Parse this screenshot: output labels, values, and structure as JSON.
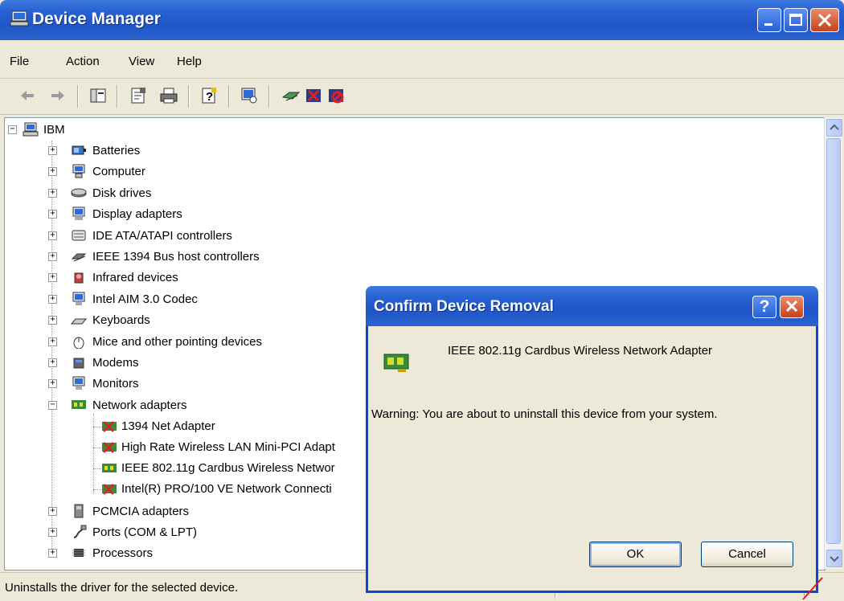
{
  "window": {
    "title": "Device Manager"
  },
  "menubar": {
    "items": [
      "File",
      "Action",
      "View",
      "Help"
    ]
  },
  "toolbar": {
    "tools": [
      "back-arrow-icon",
      "forward-arrow-icon",
      "show-hide-console-tree-icon",
      "properties-icon",
      "print-icon",
      "help-icon",
      "scan-hardware-icon",
      "update-driver-icon",
      "uninstall-icon",
      "disable-icon"
    ]
  },
  "tree": {
    "root": "IBM",
    "categories": [
      "Batteries",
      "Computer",
      "Disk drives",
      "Display adapters",
      "IDE ATA/ATAPI controllers",
      "IEEE 1394 Bus host controllers",
      "Infrared devices",
      "Intel AIM 3.0 Codec",
      "Keyboards",
      "Mice and other pointing devices",
      "Modems",
      "Monitors",
      "Network adapters"
    ],
    "network_adapters": [
      "1394 Net Adapter",
      "High Rate Wireless LAN Mini-PCI Adapt",
      "IEEE 802.11g Cardbus Wireless Networ",
      "Intel(R) PRO/100 VE Network Connecti"
    ],
    "more_categories": [
      "PCMCIA adapters",
      "Ports (COM & LPT)",
      "Processors"
    ]
  },
  "statusbar": {
    "text": "Uninstalls the driver for the selected device."
  },
  "dialog": {
    "title": "Confirm Device Removal",
    "help_label": "?",
    "device_name": "IEEE 802.11g Cardbus Wireless Network Adapter",
    "warning": "Warning: You are about to uninstall this device from your system.",
    "ok_label": "OK",
    "cancel_label": "Cancel"
  },
  "colors": {
    "titlebar": "#2a63d3",
    "window_bg": "#ece9d8",
    "close_button": "#c6421f",
    "annotation_line": "#e02020"
  }
}
